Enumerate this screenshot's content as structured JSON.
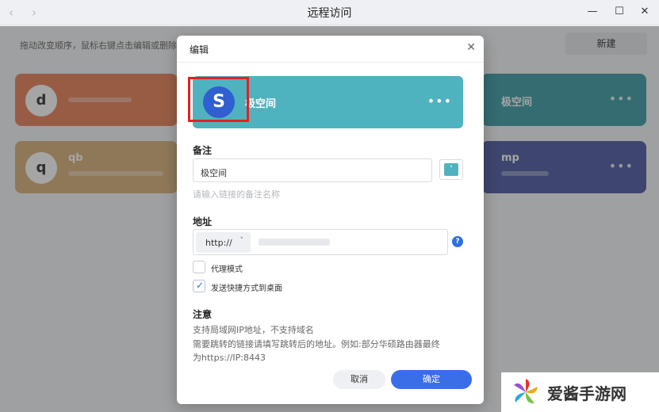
{
  "window": {
    "title": "远程访问",
    "back_icon": "‹",
    "forward_icon": "›",
    "minimize_icon": "—",
    "maximize_icon": "☐",
    "close_icon": "✕"
  },
  "page": {
    "hint": "拖动改变顺序，鼠标右键点击编辑或删除",
    "new_button": "新建",
    "cards": [
      {
        "letter": "d",
        "name": "",
        "color": "#e9825a"
      },
      {
        "letter": "",
        "name": "极空间",
        "color": "#3d9ea6"
      },
      {
        "letter": "q",
        "name": "qb",
        "color": "#d7b27a"
      },
      {
        "letter": "",
        "name": "mp",
        "color": "#4e5aa0"
      }
    ],
    "card_dots": "•••"
  },
  "dialog": {
    "title": "编辑",
    "close_icon": "✕",
    "preview": {
      "logo_letter": "S",
      "name": "极空间",
      "dots": "•••",
      "color": "#4fb3bf"
    },
    "remark_label": "备注",
    "remark_value": "极空间",
    "remark_help": "请输入链接的备注名称",
    "address_label": "地址",
    "protocol": "http://",
    "protocol_chevron": "˅",
    "help_icon": "?",
    "proxy_mode_label": "代理模式",
    "proxy_mode_checked": false,
    "desktop_shortcut_label": "发送快捷方式到桌面",
    "desktop_shortcut_checked": true,
    "check_icon": "✓",
    "notice_label": "注意",
    "notice_lines": [
      "支持局域网IP地址，不支持域名",
      "需要跳转的链接请填写跳转后的地址。例如:部分华硕路由器最终",
      "为https://IP:8443"
    ],
    "cancel_button": "取消",
    "ok_button": "确定"
  },
  "watermark": {
    "text": "爱酱手游网"
  }
}
